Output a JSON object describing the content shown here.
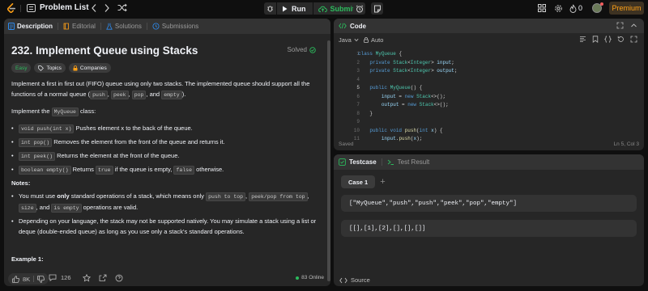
{
  "topbar": {
    "problem_list_label": "Problem List",
    "run_label": "Run",
    "submit_label": "Submit",
    "streak_count": "0",
    "premium_label": "Premium"
  },
  "description_panel": {
    "tabs": [
      {
        "label": "Description",
        "icon": "document-icon",
        "active": true
      },
      {
        "label": "Editorial",
        "icon": "book-icon",
        "active": false
      },
      {
        "label": "Solutions",
        "icon": "flask-icon",
        "active": false
      },
      {
        "label": "Submissions",
        "icon": "history-icon",
        "active": false
      }
    ],
    "title": "232. Implement Queue using Stacks",
    "status": "Solved",
    "difficulty": "Easy",
    "chips": [
      "Topics",
      "Companies"
    ],
    "intro_1": "Implement a first in first out (FIFO) queue using only two stacks. The implemented queue should support all the functions of a normal queue (",
    "intro_codes": [
      "push",
      "peek",
      "pop",
      "empty"
    ],
    "intro_sep": ", ",
    "intro_and": "and ",
    "intro_end": ").",
    "implement_pre": "Implement the ",
    "implement_code": "MyQueue",
    "implement_post": " class:",
    "methods": [
      {
        "code": "void push(int x)",
        "text": " Pushes element x to the back of the queue."
      },
      {
        "code": "int pop()",
        "text": " Removes the element from the front of the queue and returns it."
      },
      {
        "code": "int peek()",
        "text": " Returns the element at the front of the queue."
      },
      {
        "code": "boolean empty()",
        "text_pre": " Returns ",
        "code2": "true",
        "text_mid": " if the queue is empty, ",
        "code3": "false",
        "text_post": " otherwise."
      }
    ],
    "notes_heading": "Notes:",
    "note1_pre": "You must use ",
    "note1_bold": "only",
    "note1_mid": " standard operations of a stack, which means only ",
    "note1_code1": "push to top",
    "note1_code2": "peek/pop from top",
    "note1_code3": "size",
    "note1_and": ", and ",
    "note1_code4": "is empty",
    "note1_post": " operations are valid.",
    "note2": "Depending on your language, the stack may not be supported natively. You may simulate a stack using a list or deque (double-ended queue) as long as you use only a stack's standard operations.",
    "example_heading": "Example 1:",
    "likes": "8K",
    "comments": "126",
    "online": "83 Online"
  },
  "code_panel": {
    "title": "Code",
    "language": "Java",
    "mode": "Auto",
    "status_left": "Saved",
    "status_right": "Ln 5, Col 3",
    "line_numbers": [
      "1",
      "2",
      "3",
      "4",
      "5",
      "6",
      "7",
      "8",
      "9",
      "10",
      "11"
    ],
    "lines": [
      "class MyQueue {",
      "    private Stack<Integer> input;",
      "    private Stack<Integer> output;",
      "",
      "    public MyQueue() {",
      "        input = new Stack<>();",
      "        output = new Stack<>();",
      "    }",
      "",
      "    public void push(int x) {",
      "        input.push(x);"
    ]
  },
  "testcase_panel": {
    "tabs": [
      {
        "label": "Testcase",
        "active": true
      },
      {
        "label": "Test Result",
        "active": false
      }
    ],
    "case_label": "Case 1",
    "add_label": "+",
    "input_ops": "[\"MyQueue\",\"push\",\"push\",\"peek\",\"pop\",\"empty\"]",
    "input_args": "[[],[1],[2],[],[],[]]",
    "source_label": "Source"
  },
  "colors": {
    "accent_green": "#2cbb5d",
    "premium_orange": "#ffa116",
    "description_tab_icon": "#2d8cf0"
  }
}
